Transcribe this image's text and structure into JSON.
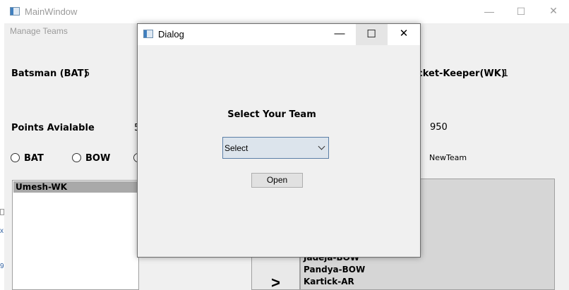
{
  "main_window": {
    "title": "MainWindow",
    "controls": {
      "minimize": "—",
      "maximize": "☐",
      "close": "✕"
    },
    "menu": [
      "Manage Teams"
    ],
    "stats": {
      "batsman_label": "Batsman (BAT)",
      "batsman_value": "5",
      "wicketkeeper_label": "cket-Keeper(WK)",
      "wicketkeeper_value": "1",
      "points_available_label": "Points Avialable",
      "points_available_value": "5",
      "points_used_value": "950"
    },
    "radios": [
      {
        "label": "BAT"
      },
      {
        "label": "BOW"
      }
    ],
    "team_name": "NewTeam",
    "left_list": {
      "selected_item": "Umesh-WK"
    },
    "right_list": {
      "items": [
        "Jadeja-BOW",
        "Pandya-BOW",
        "Kartick-AR"
      ]
    },
    "move_button": ">"
  },
  "dialog": {
    "title": "Dialog",
    "controls": {
      "minimize": "—",
      "maximize": "☐",
      "close": "✕"
    },
    "heading": "Select  Your Team",
    "combo_value": "Select",
    "open_button": "Open"
  },
  "colors": {
    "window_bg": "#f0f0f0",
    "right_list_bg": "#d6d6d6",
    "selection_bg": "#a9a9a9",
    "combo_bg": "#dce4ec",
    "combo_border": "#5b7fa6"
  }
}
